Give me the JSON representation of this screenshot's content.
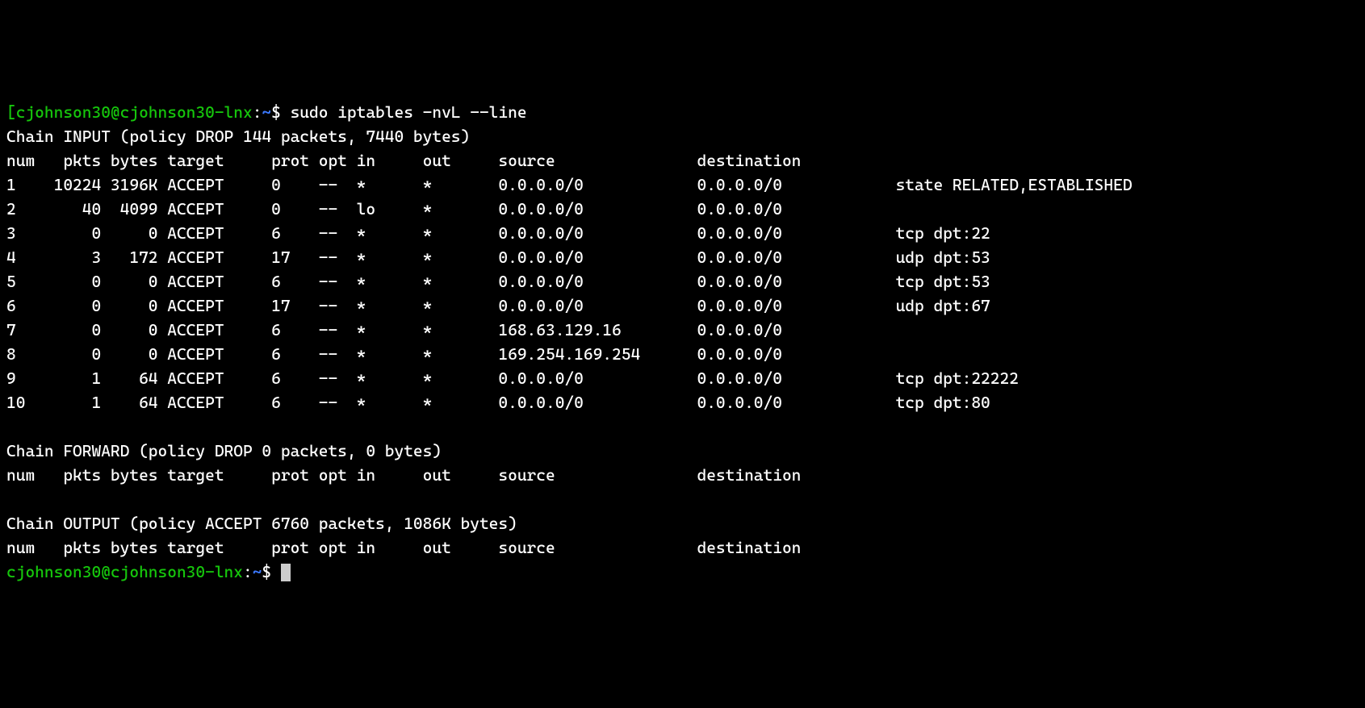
{
  "prompt": {
    "bracket": "[",
    "user_host": "cjohnson30@cjohnson30-lnx",
    "colon": ":",
    "path": "~",
    "dollar": "$ ",
    "command": "sudo iptables -nvL --line"
  },
  "chain_input_header": "Chain INPUT (policy DROP 144 packets, 7440 bytes)",
  "columns_line": "num   pkts bytes target     prot opt in     out     source               destination         ",
  "input_rows": [
    "1    10224 3196K ACCEPT     0    --  *      *       0.0.0.0/0            0.0.0.0/0            state RELATED,ESTABLISHED",
    "2       40  4099 ACCEPT     0    --  lo     *       0.0.0.0/0            0.0.0.0/0           ",
    "3        0     0 ACCEPT     6    --  *      *       0.0.0.0/0            0.0.0.0/0            tcp dpt:22",
    "4        3   172 ACCEPT     17   --  *      *       0.0.0.0/0            0.0.0.0/0            udp dpt:53",
    "5        0     0 ACCEPT     6    --  *      *       0.0.0.0/0            0.0.0.0/0            tcp dpt:53",
    "6        0     0 ACCEPT     17   --  *      *       0.0.0.0/0            0.0.0.0/0            udp dpt:67",
    "7        0     0 ACCEPT     6    --  *      *       168.63.129.16        0.0.0.0/0           ",
    "8        0     0 ACCEPT     6    --  *      *       169.254.169.254      0.0.0.0/0           ",
    "9        1    64 ACCEPT     6    --  *      *       0.0.0.0/0            0.0.0.0/0            tcp dpt:22222",
    "10       1    64 ACCEPT     6    --  *      *       0.0.0.0/0            0.0.0.0/0            tcp dpt:80"
  ],
  "blank": "",
  "chain_forward_header": "Chain FORWARD (policy DROP 0 packets, 0 bytes)",
  "forward_columns": "num   pkts bytes target     prot opt in     out     source               destination         ",
  "chain_output_header": "Chain OUTPUT (policy ACCEPT 6760 packets, 1086K bytes)",
  "output_columns": "num   pkts bytes target     prot opt in     out     source               destination         ",
  "prompt2": {
    "user_host": "cjohnson30@cjohnson30-lnx",
    "colon": ":",
    "path": "~",
    "dollar": "$ "
  }
}
